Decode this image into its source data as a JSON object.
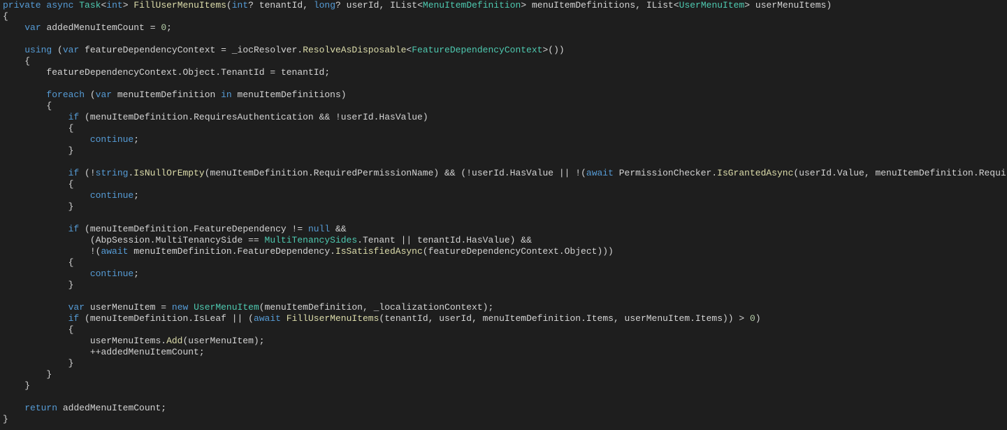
{
  "language": "csharp",
  "tokens": {
    "kw_private": "private",
    "kw_async": "async",
    "ty_Task": "Task",
    "kw_int": "int",
    "gt": ">",
    "lt": "<",
    "fn_FillUserMenuItems": "FillUserMenuItems",
    "kw_intq": "int",
    "q": "?",
    "p_tenantId": "tenantId",
    "kw_longq": "long",
    "p_userId": "userId",
    "ty_IList": "IList",
    "ty_MenuItemDefinition": "MenuItemDefinition",
    "p_menuItemDefinitions": "menuItemDefinitions",
    "ty_UserMenuItem": "UserMenuItem",
    "p_userMenuItems": "userMenuItems",
    "kw_var": "var",
    "id_addedMenuItemCount": "addedMenuItemCount",
    "num_0": "0",
    "kw_using": "using",
    "id_featureDependencyContext": "featureDependencyContext",
    "id_iocResolver": "_iocResolver",
    "fn_ResolveAsDisposable": "ResolveAsDisposable",
    "ty_FeatureDependencyContext": "FeatureDependencyContext",
    "id_Object": "Object",
    "id_TenantId": "TenantId",
    "kw_foreach": "foreach",
    "id_menuItemDefinition": "menuItemDefinition",
    "kw_in": "in",
    "kw_if": "if",
    "id_RequiresAuthentication": "RequiresAuthentication",
    "id_HasValue": "HasValue",
    "kw_continue": "continue",
    "kw_string": "string",
    "fn_IsNullOrEmpty": "IsNullOrEmpty",
    "id_RequiredPermissionName": "RequiredPermissionName",
    "kw_await": "await",
    "id_PermissionChecker": "PermissionChecker",
    "fn_IsGrantedAsync": "IsGrantedAsync",
    "id_Value": "Value",
    "id_FeatureDependency": "FeatureDependency",
    "kw_null": "null",
    "id_AbpSession": "AbpSession",
    "id_MultiTenancySide": "MultiTenancySide",
    "ty_MultiTenancySides": "MultiTenancySides",
    "id_Tenant": "Tenant",
    "fn_IsSatisfiedAsync": "IsSatisfiedAsync",
    "id_userMenuItem": "userMenuItem",
    "kw_new": "new",
    "id_localizationContext": "_localizationContext",
    "id_IsLeaf": "IsLeaf",
    "id_Items": "Items",
    "fn_Add": "Add",
    "kw_return": "return"
  }
}
